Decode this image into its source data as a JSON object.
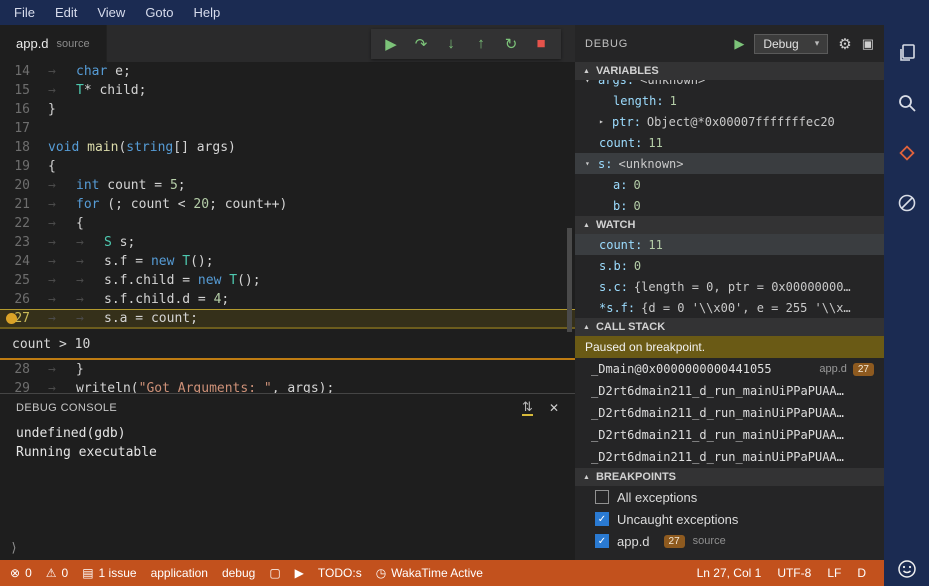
{
  "colors": {
    "titlebar": "#1b2b52",
    "status_bar": "#c2511d",
    "accent_green": "#7cc379",
    "stop_red": "#e5534b",
    "breakpoint_yellow": "#dba327",
    "selection_gray": "#3a3d40",
    "paused_banner": "#6a5a15",
    "line_badge": "#8e5a1f"
  },
  "check_glyph": "✓",
  "menubar": {
    "items": [
      "File",
      "Edit",
      "View",
      "Goto",
      "Help"
    ]
  },
  "tab": {
    "name": "app.d",
    "hint": "source"
  },
  "debug_toolbar": {
    "buttons": [
      {
        "name": "continue",
        "glyph": "▶",
        "color": "#7cc379"
      },
      {
        "name": "step-over",
        "glyph": "↷",
        "color": "#7cc379"
      },
      {
        "name": "step-into",
        "glyph": "↓",
        "color": "#7cc379"
      },
      {
        "name": "step-out",
        "glyph": "↑",
        "color": "#7cc379"
      },
      {
        "name": "restart",
        "glyph": "↻",
        "color": "#7cc379"
      },
      {
        "name": "stop",
        "glyph": "■",
        "color": "#e5534b"
      }
    ]
  },
  "editor": {
    "breakpoint_line": 27,
    "peek_text": "count > 10",
    "lines": [
      {
        "num": 14,
        "segments": [
          {
            "t": "→",
            "c": "ws"
          },
          {
            "t": "char",
            "c": "kw"
          },
          {
            "t": " e;",
            "c": "pl"
          }
        ]
      },
      {
        "num": 15,
        "segments": [
          {
            "t": "→",
            "c": "ws"
          },
          {
            "t": "T",
            "c": "ty"
          },
          {
            "t": "* child;",
            "c": "pl"
          }
        ]
      },
      {
        "num": 16,
        "segments": [
          {
            "t": "}",
            "c": "pl"
          }
        ]
      },
      {
        "num": 17,
        "segments": []
      },
      {
        "num": 18,
        "segments": [
          {
            "t": "void",
            "c": "kw"
          },
          {
            "t": " ",
            "c": "pl"
          },
          {
            "t": "main",
            "c": "fn"
          },
          {
            "t": "(",
            "c": "pl"
          },
          {
            "t": "string",
            "c": "kw"
          },
          {
            "t": "[] args)",
            "c": "pl"
          }
        ]
      },
      {
        "num": 19,
        "segments": [
          {
            "t": "{",
            "c": "pl"
          }
        ]
      },
      {
        "num": 20,
        "segments": [
          {
            "t": "→",
            "c": "ws"
          },
          {
            "t": "int",
            "c": "kw"
          },
          {
            "t": " count = ",
            "c": "pl"
          },
          {
            "t": "5",
            "c": "numlit"
          },
          {
            "t": ";",
            "c": "pl"
          }
        ]
      },
      {
        "num": 21,
        "segments": [
          {
            "t": "→",
            "c": "ws"
          },
          {
            "t": "for",
            "c": "kw"
          },
          {
            "t": " (; count < ",
            "c": "pl"
          },
          {
            "t": "20",
            "c": "numlit"
          },
          {
            "t": "; count++)",
            "c": "pl"
          }
        ]
      },
      {
        "num": 22,
        "segments": [
          {
            "t": "→",
            "c": "ws"
          },
          {
            "t": "{",
            "c": "pl"
          }
        ]
      },
      {
        "num": 23,
        "segments": [
          {
            "t": "→",
            "c": "ws"
          },
          {
            "t": "→",
            "c": "ws"
          },
          {
            "t": "S",
            "c": "ty"
          },
          {
            "t": " s;",
            "c": "pl"
          }
        ]
      },
      {
        "num": 24,
        "segments": [
          {
            "t": "→",
            "c": "ws"
          },
          {
            "t": "→",
            "c": "ws"
          },
          {
            "t": "s.f = ",
            "c": "pl"
          },
          {
            "t": "new",
            "c": "kw"
          },
          {
            "t": " ",
            "c": "pl"
          },
          {
            "t": "T",
            "c": "ty"
          },
          {
            "t": "();",
            "c": "pl"
          }
        ]
      },
      {
        "num": 25,
        "segments": [
          {
            "t": "→",
            "c": "ws"
          },
          {
            "t": "→",
            "c": "ws"
          },
          {
            "t": "s.f.child = ",
            "c": "pl"
          },
          {
            "t": "new",
            "c": "kw"
          },
          {
            "t": " ",
            "c": "pl"
          },
          {
            "t": "T",
            "c": "ty"
          },
          {
            "t": "();",
            "c": "pl"
          }
        ]
      },
      {
        "num": 26,
        "segments": [
          {
            "t": "→",
            "c": "ws"
          },
          {
            "t": "→",
            "c": "ws"
          },
          {
            "t": "s.f.child.d = ",
            "c": "pl"
          },
          {
            "t": "4",
            "c": "numlit"
          },
          {
            "t": ";",
            "c": "pl"
          }
        ]
      },
      {
        "num": 27,
        "segments": [
          {
            "t": "→",
            "c": "ws"
          },
          {
            "t": "→",
            "c": "ws"
          },
          {
            "t": "s.a = count;",
            "c": "pl"
          }
        ]
      },
      {
        "num": 28,
        "segments": [
          {
            "t": "→",
            "c": "ws"
          },
          {
            "t": "}",
            "c": "pl"
          }
        ]
      },
      {
        "num": 29,
        "segments": [
          {
            "t": "→",
            "c": "ws"
          },
          {
            "t": "writeln(",
            "c": "pl"
          },
          {
            "t": "\"Got Arguments: \"",
            "c": "str"
          },
          {
            "t": ", args);",
            "c": "pl"
          }
        ]
      }
    ]
  },
  "console": {
    "title": "DEBUG CONSOLE",
    "filter_glyph": "⇅",
    "close_glyph": "✕",
    "lines": [
      "undefined(gdb)",
      "Running executable"
    ],
    "prompt": "⟩"
  },
  "debug_panel": {
    "title": "DEBUG",
    "config": "Debug",
    "caret_glyph": "▾",
    "play_glyph": "▶",
    "gear_glyph": "⚙",
    "console_glyph": "▣",
    "section_twisty": "▲",
    "sections": {
      "variables": {
        "label": "VARIABLES",
        "rows": [
          {
            "name": "args",
            "value": "<unknown>",
            "arrow": "▾",
            "depth": 0,
            "cut": true
          },
          {
            "name": "length",
            "value": "1",
            "depth": 2,
            "num": true
          },
          {
            "name": "ptr",
            "value": "Object@*0x00007fffffffec20",
            "arrow": "▸",
            "depth": 1
          },
          {
            "name": "count",
            "value": "11",
            "depth": 1,
            "num": true
          },
          {
            "name": "s",
            "value": "<unknown>",
            "arrow": "▾",
            "depth": 0,
            "selected": true
          },
          {
            "name": "a",
            "value": "0",
            "depth": 2,
            "num": true
          },
          {
            "name": "b",
            "value": "0",
            "depth": 2,
            "num": true
          }
        ]
      },
      "watch": {
        "label": "WATCH",
        "rows": [
          {
            "name": "count",
            "value": "11",
            "depth": 1,
            "num": true,
            "selected": true
          },
          {
            "name": "s.b",
            "value": "0",
            "depth": 1,
            "num": true
          },
          {
            "name": "s.c",
            "value": "{length = 0, ptr = 0x00000000…",
            "depth": 1
          },
          {
            "name": "*s.f",
            "value": "{d = 0 '\\\\x00', e = 255 '\\\\x…",
            "depth": 1
          }
        ]
      },
      "call_stack": {
        "label": "CALL STACK",
        "banner": "Paused on breakpoint.",
        "frames": [
          {
            "fn": "_Dmain@0x0000000000441055",
            "file": "app.d",
            "line": "27"
          },
          {
            "fn": "_D2rt6dmain211_d_run_mainUiPPaPUAA…"
          },
          {
            "fn": "_D2rt6dmain211_d_run_mainUiPPaPUAA…"
          },
          {
            "fn": "_D2rt6dmain211_d_run_mainUiPPaPUAA…"
          },
          {
            "fn": "_D2rt6dmain211_d_run_mainUiPPaPUAA…"
          }
        ]
      },
      "breakpoints": {
        "label": "BREAKPOINTS",
        "rows": [
          {
            "label": "All exceptions",
            "checked": false
          },
          {
            "label": "Uncaught exceptions",
            "checked": true
          },
          {
            "label": "app.d",
            "checked": true,
            "badge": "27",
            "hint": "source"
          }
        ]
      }
    }
  },
  "activity_bar": {
    "items": [
      "files-icon",
      "search-icon",
      "diamond-icon",
      "debug-off-icon"
    ],
    "bottom": "smiley-icon"
  },
  "status_bar": {
    "left": [
      {
        "name": "errors",
        "glyph": "⊗",
        "label": "0"
      },
      {
        "name": "warnings",
        "glyph": "⚠",
        "label": "0"
      },
      {
        "name": "issues",
        "glyph": "▤",
        "label": "1 issue"
      },
      {
        "name": "application",
        "label": "application"
      },
      {
        "name": "debug-config",
        "label": "debug"
      },
      {
        "name": "file",
        "glyph": "▢"
      },
      {
        "name": "run",
        "glyph": "▶"
      },
      {
        "name": "todos",
        "label": "TODO:s"
      },
      {
        "name": "wakatime",
        "glyph": "◷",
        "label": "WakaTime Active"
      }
    ],
    "right": [
      {
        "name": "cursor-position",
        "label": "Ln 27, Col 1"
      },
      {
        "name": "encoding",
        "label": "UTF-8"
      },
      {
        "name": "eol",
        "label": "LF"
      },
      {
        "name": "language-mode",
        "label": "D"
      }
    ]
  }
}
